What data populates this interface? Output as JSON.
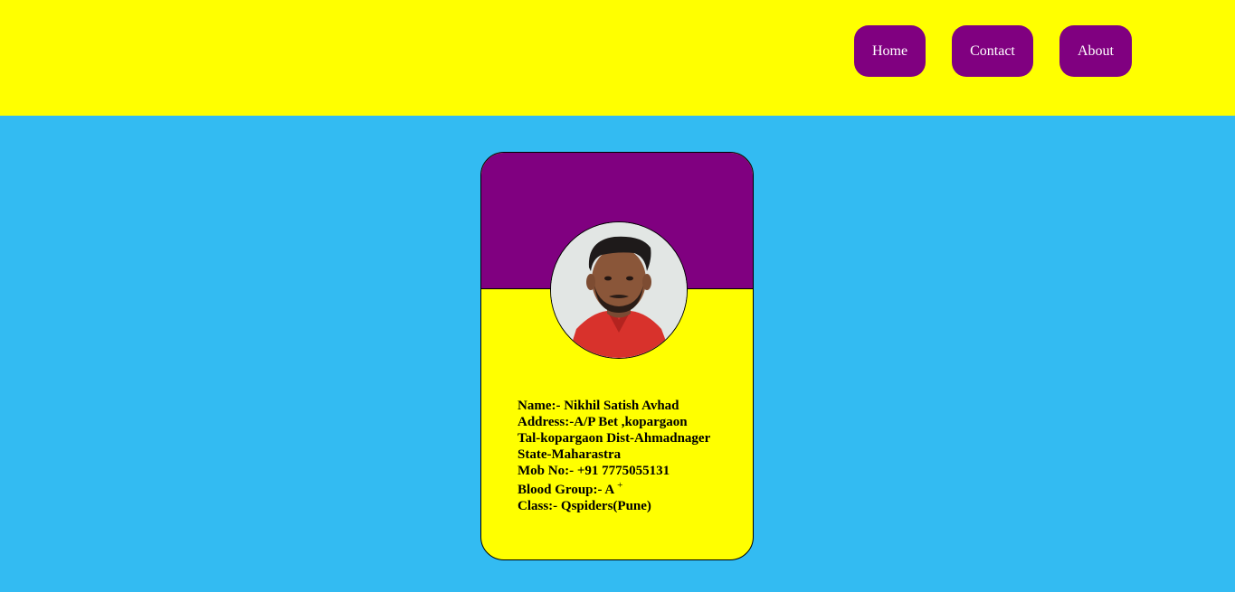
{
  "header": {
    "nav": [
      {
        "label": "Home"
      },
      {
        "label": "Contact"
      },
      {
        "label": "About"
      }
    ]
  },
  "card": {
    "photo": "profile-photo",
    "name": "Name:- Nikhil Satish Avhad",
    "address_line1": "Address:-A/P Bet ,kopargaon",
    "address_line2": "Tal-kopargaon Dist-Ahmadnager",
    "address_line3": "State-Maharastra",
    "mobile": "Mob No:- +91 7775055131",
    "blood_group": "Blood Group:- A",
    "blood_sign": "+",
    "class": "Class:- Qspiders(Pune)"
  },
  "colors": {
    "header_bg": "#ffff00",
    "page_bg": "#33bbf2",
    "accent": "#800080",
    "card_bottom": "#ffff00"
  }
}
